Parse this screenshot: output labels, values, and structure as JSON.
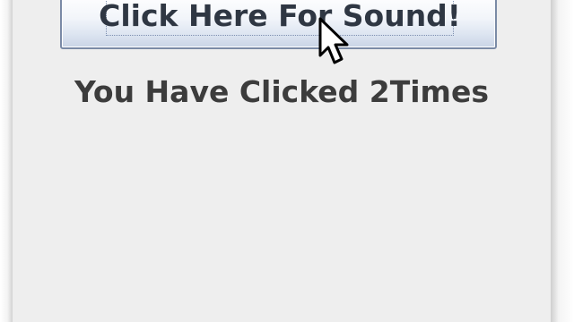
{
  "button": {
    "label": "Click Here For Sound!"
  },
  "status": {
    "click_count_text": "You Have Clicked 2Times"
  },
  "icons": {
    "cursor": "mouse-pointer-icon"
  },
  "colors": {
    "panel_background": "#eeeeee",
    "button_border": "#7a8aa6",
    "text": "#3c3c3c"
  }
}
